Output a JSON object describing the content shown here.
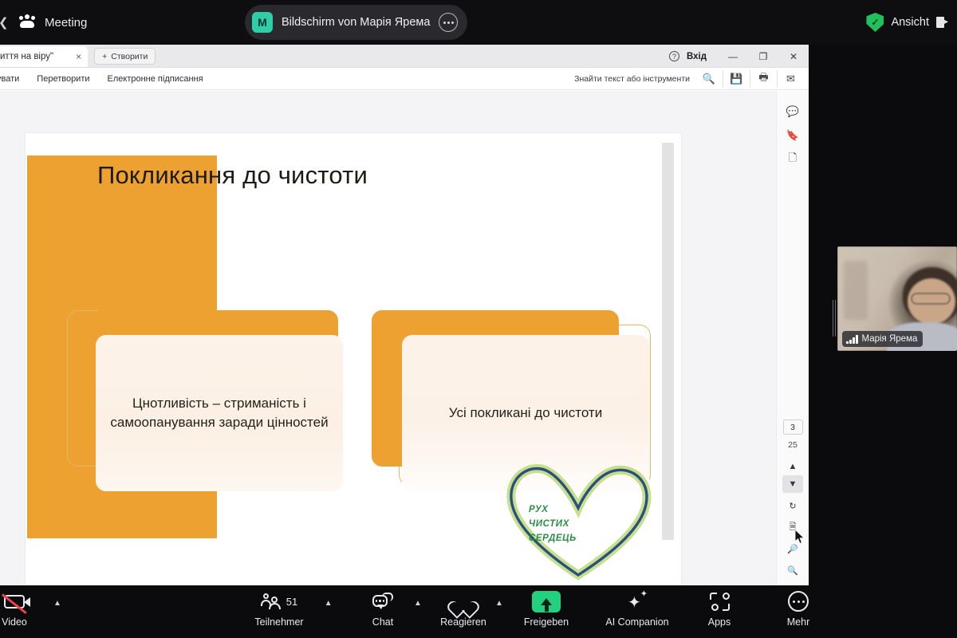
{
  "meeting_topbar": {
    "left_chevron": "chevron-left-icon",
    "people_icon": "people-icon",
    "meeting_label": "Meeting",
    "share_badge": {
      "avatar_initial": "M",
      "title": "Bildschirm von Марія Ярема",
      "more_icon": "more-dots-icon"
    },
    "security_icon": "shield-check-icon",
    "view_label": "Ansicht",
    "view_icon": "layout-view-icon",
    "accent_green": "#20c15c"
  },
  "pdf_window": {
    "tab": {
      "title": "иття на віру\"",
      "close": "×"
    },
    "new_tab_label": "Створити",
    "new_tab_plus": "+",
    "help_icon": "question-circle-icon",
    "signin_label": "Вхід",
    "minimize": "—",
    "maximize": "❐",
    "close": "✕",
    "menu_items": [
      "гувати",
      "Перетворити",
      "Електронне підписання"
    ],
    "find_placeholder": "Знайти текст або інструменти",
    "search_icon": "search-icon",
    "save_icon": "save-icon",
    "print_icon": "print-icon",
    "mail_icon": "mail-icon",
    "rail_top_icons": [
      "comment-icon",
      "bookmark-icon",
      "copy-pages-icon"
    ],
    "page_current": "3",
    "page_total": "25",
    "nav_prev_icon": "chevron-up-icon",
    "nav_next_icon": "chevron-down-icon",
    "rotate_icon": "rotate-clockwise-icon",
    "fit_page_icon": "fit-page-icon",
    "zoom_in_icon": "zoom-in-icon",
    "zoom_out_icon": "zoom-out-icon"
  },
  "slide": {
    "title": "Покликання до чистоти",
    "cards": [
      {
        "text": "Цнотливість – стриманість і самоопанування заради цінностей"
      },
      {
        "text": "Усі покликані до чистоти"
      }
    ],
    "logo": {
      "name": "heart-logo",
      "lines": [
        "РУХ",
        "ЧИСТИХ",
        "СЕРДЕЦЬ"
      ],
      "text_color": "#2e8b46",
      "outline_color": "#2b4f82",
      "glow_color": "#9ccb4b"
    },
    "accent_orange": "#eda130",
    "card_fill": "#fdf2e7"
  },
  "participant_panel": {
    "name": "Марія Ярема",
    "signal_icon": "signal-bars-icon",
    "resize_handle": "panel-resize-handle"
  },
  "bottom_toolbar": {
    "items": [
      {
        "label": "Video",
        "icon": "camera-off-icon",
        "caret": true,
        "muted": true
      },
      {
        "label": "Teilnehmer",
        "icon": "participants-icon",
        "caret": true,
        "badge": "51"
      },
      {
        "label": "Chat",
        "icon": "chat-icon",
        "caret": true
      },
      {
        "label": "Reagieren",
        "icon": "heart-icon",
        "caret": true
      },
      {
        "label": "Freigeben",
        "icon": "share-screen-icon",
        "caret": false,
        "highlight": "#22d17e"
      },
      {
        "label": "AI Companion",
        "icon": "sparkle-icon",
        "caret": false
      },
      {
        "label": "Apps",
        "icon": "apps-icon",
        "caret": false
      },
      {
        "label": "Mehr",
        "icon": "more-circle-icon",
        "caret": false
      }
    ]
  }
}
